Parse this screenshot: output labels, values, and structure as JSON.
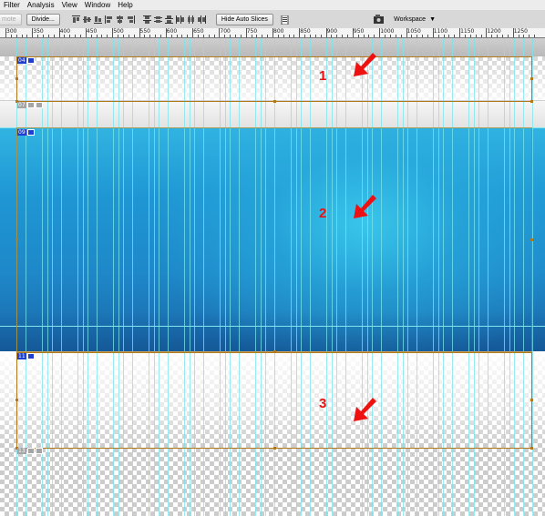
{
  "menubar": {
    "items": [
      "Filter",
      "Analysis",
      "View",
      "Window",
      "Help"
    ]
  },
  "options_bar": {
    "auto_label": "mote",
    "divide_label": "Divide...",
    "hide_auto_slices_label": "Hide Auto Slices",
    "workspace_label": "Workspace"
  },
  "ruler": {
    "labels": [
      "300",
      "350",
      "400",
      "450",
      "500",
      "550",
      "600",
      "650",
      "700",
      "750",
      "800",
      "850",
      "900",
      "950",
      "1000",
      "1050",
      "1100",
      "1150",
      "1200",
      "1250"
    ]
  },
  "slices": {
    "s04": "04",
    "s07": "07",
    "s09": "09",
    "s11": "11",
    "s13": "13"
  },
  "annotations": {
    "n1": "1",
    "n2": "2",
    "n3": "3"
  },
  "colors": {
    "annotation": "#ee1111",
    "guide": "#7fe6ee",
    "slice_line": "#b07a1a",
    "slice_badge": "#1e3fd0"
  }
}
